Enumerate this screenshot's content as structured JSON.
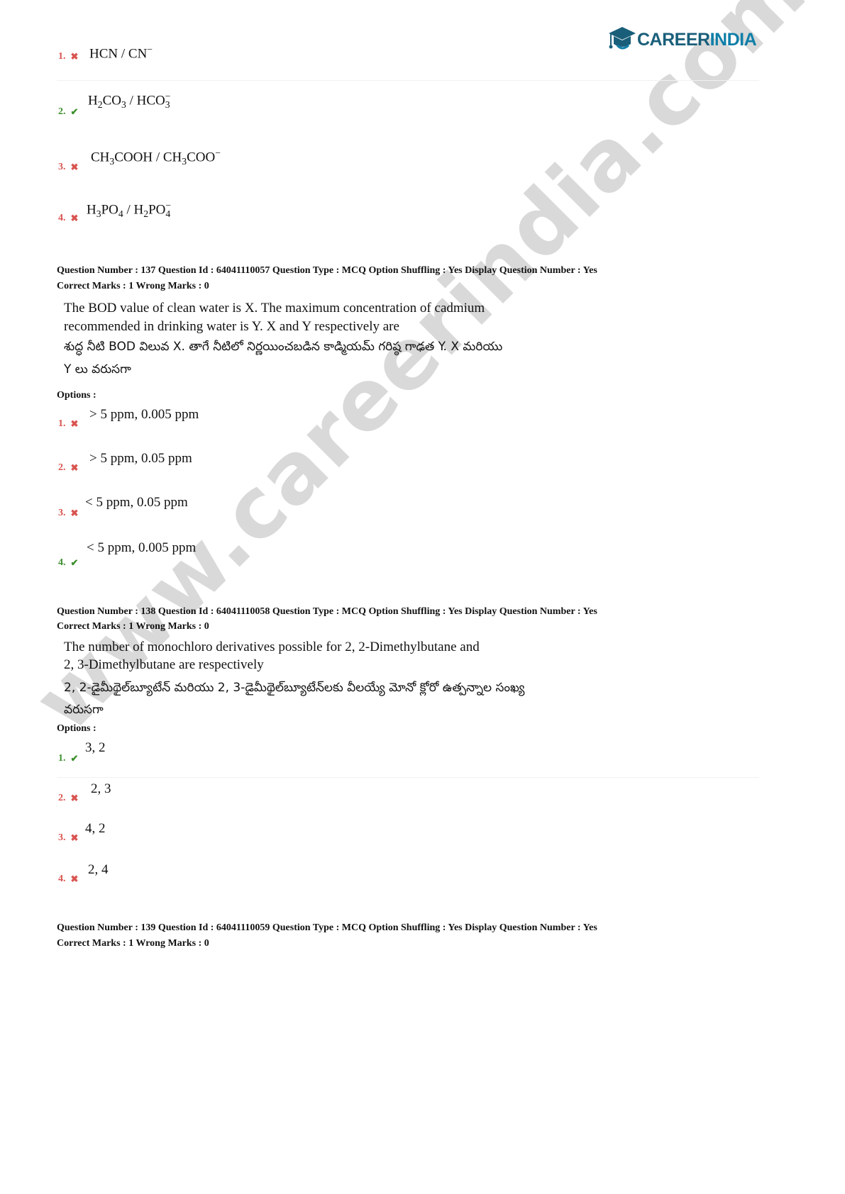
{
  "logo": {
    "part1": "CAREER",
    "part2": "INDIA"
  },
  "watermark": "www.careerindia.com",
  "top_options": [
    {
      "num": "1.",
      "status": "wrong"
    },
    {
      "num": "2.",
      "status": "correct"
    },
    {
      "num": "3.",
      "status": "wrong"
    },
    {
      "num": "4.",
      "status": "wrong"
    }
  ],
  "q137": {
    "meta_line1": "Question Number : 137 Question Id : 64041110057 Question Type : MCQ Option Shuffling : Yes Display Question Number : Yes",
    "meta_line2": "Correct Marks : 1 Wrong Marks : 0",
    "text_en_1": "The BOD value of clean water is X. The maximum concentration of cadmium",
    "text_en_2": "recommended in drinking water is Y.  X and Y respectively are",
    "text_te_1": "శుద్ధ నీటి BOD విలువ X. తాగే నీటిలో నిర్ణయించబడిన కాడ్మియమ్ గరిష్ఠ గాఢత Y. X మరియు",
    "text_te_2": "Y లు వరుసగా",
    "options_label": "Options :",
    "options": [
      {
        "num": "1.",
        "status": "wrong",
        "text": "> 5 ppm, 0.005 ppm"
      },
      {
        "num": "2.",
        "status": "wrong",
        "text": "> 5 ppm, 0.05 ppm"
      },
      {
        "num": "3.",
        "status": "wrong",
        "text": "< 5 ppm, 0.05 ppm"
      },
      {
        "num": "4.",
        "status": "correct",
        "text": "< 5 ppm, 0.005 ppm"
      }
    ]
  },
  "q138": {
    "meta_line1": "Question Number : 138 Question Id : 64041110058 Question Type : MCQ Option Shuffling : Yes Display Question Number : Yes",
    "meta_line2": "Correct Marks : 1 Wrong Marks : 0",
    "text_en_1": "The number of monochloro derivatives possible for 2, 2-Dimethylbutane and",
    "text_en_2": "2, 3-Dimethylbutane are respectively",
    "text_te_1": "2, 2-డైమీథైల్‌బ్యూటేన్ మరియు 2, 3-డైమీథైల్‌బ్యూటేన్‌లకు వీలయ్యే మోనో క్లోరో ఉత్పన్నాల సంఖ్య",
    "text_te_2": "వరుసగా",
    "options_label": "Options :",
    "options": [
      {
        "num": "1.",
        "status": "correct",
        "text": "3, 2"
      },
      {
        "num": "2.",
        "status": "wrong",
        "text": "2, 3"
      },
      {
        "num": "3.",
        "status": "wrong",
        "text": "4, 2"
      },
      {
        "num": "4.",
        "status": "wrong",
        "text": "2, 4"
      }
    ]
  },
  "q139": {
    "meta_line1": "Question Number : 139 Question Id : 64041110059 Question Type : MCQ Option Shuffling : Yes Display Question Number : Yes",
    "meta_line2": "Correct Marks : 1 Wrong Marks : 0"
  },
  "icons": {
    "correct": "check-icon",
    "wrong": "cross-icon"
  },
  "colors": {
    "correct": "#3c8f2c",
    "wrong": "#d9534f",
    "watermark": "#cfcfcf",
    "logo": "#1a5f7a"
  }
}
